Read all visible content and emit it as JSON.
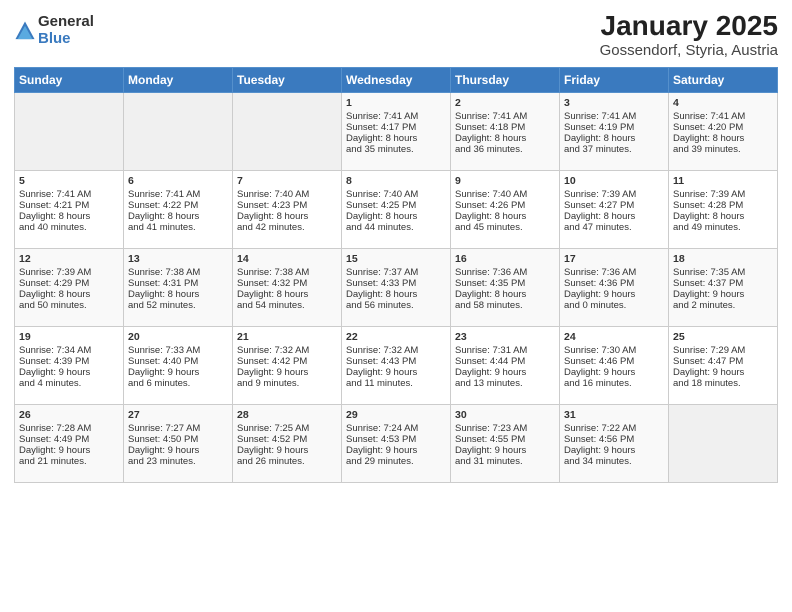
{
  "logo": {
    "general": "General",
    "blue": "Blue"
  },
  "title": "January 2025",
  "subtitle": "Gossendorf, Styria, Austria",
  "weekdays": [
    "Sunday",
    "Monday",
    "Tuesday",
    "Wednesday",
    "Thursday",
    "Friday",
    "Saturday"
  ],
  "weeks": [
    [
      {
        "day": "",
        "empty": true
      },
      {
        "day": "",
        "empty": true
      },
      {
        "day": "",
        "empty": true
      },
      {
        "day": "1",
        "lines": [
          "Sunrise: 7:41 AM",
          "Sunset: 4:17 PM",
          "Daylight: 8 hours",
          "and 35 minutes."
        ]
      },
      {
        "day": "2",
        "lines": [
          "Sunrise: 7:41 AM",
          "Sunset: 4:18 PM",
          "Daylight: 8 hours",
          "and 36 minutes."
        ]
      },
      {
        "day": "3",
        "lines": [
          "Sunrise: 7:41 AM",
          "Sunset: 4:19 PM",
          "Daylight: 8 hours",
          "and 37 minutes."
        ]
      },
      {
        "day": "4",
        "lines": [
          "Sunrise: 7:41 AM",
          "Sunset: 4:20 PM",
          "Daylight: 8 hours",
          "and 39 minutes."
        ]
      }
    ],
    [
      {
        "day": "5",
        "lines": [
          "Sunrise: 7:41 AM",
          "Sunset: 4:21 PM",
          "Daylight: 8 hours",
          "and 40 minutes."
        ]
      },
      {
        "day": "6",
        "lines": [
          "Sunrise: 7:41 AM",
          "Sunset: 4:22 PM",
          "Daylight: 8 hours",
          "and 41 minutes."
        ]
      },
      {
        "day": "7",
        "lines": [
          "Sunrise: 7:40 AM",
          "Sunset: 4:23 PM",
          "Daylight: 8 hours",
          "and 42 minutes."
        ]
      },
      {
        "day": "8",
        "lines": [
          "Sunrise: 7:40 AM",
          "Sunset: 4:25 PM",
          "Daylight: 8 hours",
          "and 44 minutes."
        ]
      },
      {
        "day": "9",
        "lines": [
          "Sunrise: 7:40 AM",
          "Sunset: 4:26 PM",
          "Daylight: 8 hours",
          "and 45 minutes."
        ]
      },
      {
        "day": "10",
        "lines": [
          "Sunrise: 7:39 AM",
          "Sunset: 4:27 PM",
          "Daylight: 8 hours",
          "and 47 minutes."
        ]
      },
      {
        "day": "11",
        "lines": [
          "Sunrise: 7:39 AM",
          "Sunset: 4:28 PM",
          "Daylight: 8 hours",
          "and 49 minutes."
        ]
      }
    ],
    [
      {
        "day": "12",
        "lines": [
          "Sunrise: 7:39 AM",
          "Sunset: 4:29 PM",
          "Daylight: 8 hours",
          "and 50 minutes."
        ]
      },
      {
        "day": "13",
        "lines": [
          "Sunrise: 7:38 AM",
          "Sunset: 4:31 PM",
          "Daylight: 8 hours",
          "and 52 minutes."
        ]
      },
      {
        "day": "14",
        "lines": [
          "Sunrise: 7:38 AM",
          "Sunset: 4:32 PM",
          "Daylight: 8 hours",
          "and 54 minutes."
        ]
      },
      {
        "day": "15",
        "lines": [
          "Sunrise: 7:37 AM",
          "Sunset: 4:33 PM",
          "Daylight: 8 hours",
          "and 56 minutes."
        ]
      },
      {
        "day": "16",
        "lines": [
          "Sunrise: 7:36 AM",
          "Sunset: 4:35 PM",
          "Daylight: 8 hours",
          "and 58 minutes."
        ]
      },
      {
        "day": "17",
        "lines": [
          "Sunrise: 7:36 AM",
          "Sunset: 4:36 PM",
          "Daylight: 9 hours",
          "and 0 minutes."
        ]
      },
      {
        "day": "18",
        "lines": [
          "Sunrise: 7:35 AM",
          "Sunset: 4:37 PM",
          "Daylight: 9 hours",
          "and 2 minutes."
        ]
      }
    ],
    [
      {
        "day": "19",
        "lines": [
          "Sunrise: 7:34 AM",
          "Sunset: 4:39 PM",
          "Daylight: 9 hours",
          "and 4 minutes."
        ]
      },
      {
        "day": "20",
        "lines": [
          "Sunrise: 7:33 AM",
          "Sunset: 4:40 PM",
          "Daylight: 9 hours",
          "and 6 minutes."
        ]
      },
      {
        "day": "21",
        "lines": [
          "Sunrise: 7:32 AM",
          "Sunset: 4:42 PM",
          "Daylight: 9 hours",
          "and 9 minutes."
        ]
      },
      {
        "day": "22",
        "lines": [
          "Sunrise: 7:32 AM",
          "Sunset: 4:43 PM",
          "Daylight: 9 hours",
          "and 11 minutes."
        ]
      },
      {
        "day": "23",
        "lines": [
          "Sunrise: 7:31 AM",
          "Sunset: 4:44 PM",
          "Daylight: 9 hours",
          "and 13 minutes."
        ]
      },
      {
        "day": "24",
        "lines": [
          "Sunrise: 7:30 AM",
          "Sunset: 4:46 PM",
          "Daylight: 9 hours",
          "and 16 minutes."
        ]
      },
      {
        "day": "25",
        "lines": [
          "Sunrise: 7:29 AM",
          "Sunset: 4:47 PM",
          "Daylight: 9 hours",
          "and 18 minutes."
        ]
      }
    ],
    [
      {
        "day": "26",
        "lines": [
          "Sunrise: 7:28 AM",
          "Sunset: 4:49 PM",
          "Daylight: 9 hours",
          "and 21 minutes."
        ]
      },
      {
        "day": "27",
        "lines": [
          "Sunrise: 7:27 AM",
          "Sunset: 4:50 PM",
          "Daylight: 9 hours",
          "and 23 minutes."
        ]
      },
      {
        "day": "28",
        "lines": [
          "Sunrise: 7:25 AM",
          "Sunset: 4:52 PM",
          "Daylight: 9 hours",
          "and 26 minutes."
        ]
      },
      {
        "day": "29",
        "lines": [
          "Sunrise: 7:24 AM",
          "Sunset: 4:53 PM",
          "Daylight: 9 hours",
          "and 29 minutes."
        ]
      },
      {
        "day": "30",
        "lines": [
          "Sunrise: 7:23 AM",
          "Sunset: 4:55 PM",
          "Daylight: 9 hours",
          "and 31 minutes."
        ]
      },
      {
        "day": "31",
        "lines": [
          "Sunrise: 7:22 AM",
          "Sunset: 4:56 PM",
          "Daylight: 9 hours",
          "and 34 minutes."
        ]
      },
      {
        "day": "",
        "empty": true
      }
    ]
  ]
}
